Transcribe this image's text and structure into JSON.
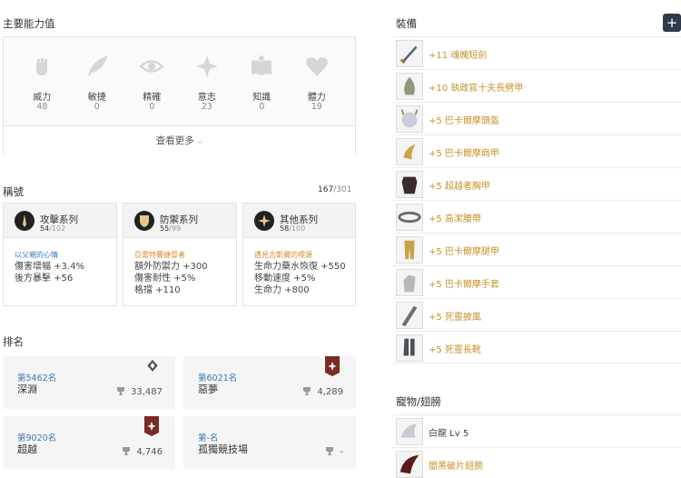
{
  "stats": {
    "title": "主要能力值",
    "items": [
      {
        "name": "威力",
        "value": "48",
        "icon": "fist-icon"
      },
      {
        "name": "敏捷",
        "value": "0",
        "icon": "feather-icon"
      },
      {
        "name": "精確",
        "value": "0",
        "icon": "eye-icon"
      },
      {
        "name": "意志",
        "value": "23",
        "icon": "burst-icon"
      },
      {
        "name": "知識",
        "value": "0",
        "icon": "book-icon"
      },
      {
        "name": "體力",
        "value": "19",
        "icon": "heart-icon"
      }
    ],
    "more_label": "查看更多"
  },
  "titles": {
    "title": "稱號",
    "count": "167",
    "total": "/301",
    "groups": [
      {
        "name": "攻擊系列",
        "count": "54",
        "total": "/102",
        "subtitle": "以父親的心情",
        "subtitle_color": "#3a78b8",
        "lines": [
          "傷害增幅 +3.4%",
          "後方暴擊 +56"
        ]
      },
      {
        "name": "防禦系列",
        "count": "55",
        "total": "/99",
        "subtitle": "亞雷特蘭捷冒者",
        "subtitle_color": "#d88a2a",
        "lines": [
          "額外防禦力 +300",
          "傷害耐性 +5%",
          "格擋 +110"
        ]
      },
      {
        "name": "其他系列",
        "count": "58",
        "total": "/100",
        "subtitle": "遇見吉凱爾的標源",
        "subtitle_color": "#d88a2a",
        "lines": [
          "生命力藥水恢復 +550",
          "移動速度 +5%",
          "生命力 +800"
        ]
      }
    ]
  },
  "ranking": {
    "title": "排名",
    "items": [
      {
        "rank": "第5462名",
        "name": "深淵",
        "score": "33,487"
      },
      {
        "rank": "第6021名",
        "name": "惡夢",
        "score": "4,289"
      },
      {
        "rank": "第9020名",
        "name": "超越",
        "score": "4,746"
      },
      {
        "rank": "第-名",
        "name": "孤獨競技場",
        "score": "-"
      }
    ]
  },
  "equipment": {
    "title": "裝備",
    "add_label": "+",
    "items": [
      "+11 魂魄短劍",
      "+10 執政官十夫長劈甲",
      "+5 巴卡爾摩頭盔",
      "+5 巴卡爾摩肩甲",
      "+5 超越者胸甲",
      "+5 高潔腰帶",
      "+5 巴卡爾摩腿甲",
      "+5 巴卡爾摩手套",
      "+5 死靈披風",
      "+5 死靈長靴"
    ]
  },
  "pets": {
    "title": "寵物/翅膀",
    "items": [
      "白龍 Lv 5",
      "闇黑破片翅膀"
    ]
  }
}
